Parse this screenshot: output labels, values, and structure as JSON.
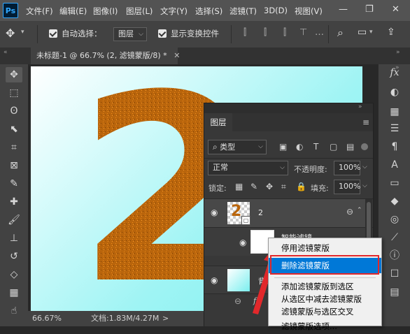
{
  "app": {
    "logo": "Ps"
  },
  "menu": [
    "文件(F)",
    "编辑(E)",
    "图像(I)",
    "图层(L)",
    "文字(Y)",
    "选择(S)",
    "滤镜(T)",
    "3D(D)",
    "视图(V)"
  ],
  "window_controls": {
    "minimize": "—",
    "restore": "❐",
    "close": "✕"
  },
  "options": {
    "auto_select_label": "自动选择：",
    "auto_select_target": "图层",
    "show_transform_label": "显示变换控件"
  },
  "document": {
    "tab_title": "未标题-1 @ 66.7% (2, 滤镜蒙版/8) *",
    "close": "✕"
  },
  "canvas": {
    "big_text": "2",
    "text_color": "#b9650c",
    "bg_color": "#7aefef"
  },
  "status": {
    "zoom": "66.67%",
    "doc_info": "文档:1.83M/4.27M",
    "arrow": ">"
  },
  "layers_panel": {
    "tab": "图层",
    "filter_kind": "类型",
    "blend_mode": "正常",
    "opacity_label": "不透明度:",
    "opacity_value": "100%",
    "lock_label": "锁定:",
    "fill_label": "填充:",
    "fill_value": "100%",
    "layers": [
      {
        "name": "2"
      },
      {
        "name": "智能滤镜"
      },
      {
        "name": "背景"
      }
    ],
    "footer_link": "⊖",
    "footer_fx": "fx"
  },
  "context_menu": {
    "items": [
      {
        "label": "停用滤镜蒙版",
        "selected": false
      },
      {
        "label": "删除滤镜蒙版",
        "selected": true
      },
      {
        "label": "添加滤镜蒙版到选区",
        "selected": false
      },
      {
        "label": "从选区中减去滤镜蒙版",
        "selected": false
      },
      {
        "label": "滤镜蒙版与选区交叉",
        "selected": false
      },
      {
        "label": "滤镜蒙版选项...",
        "selected": false
      }
    ],
    "highlight_color": "#e2282b"
  }
}
